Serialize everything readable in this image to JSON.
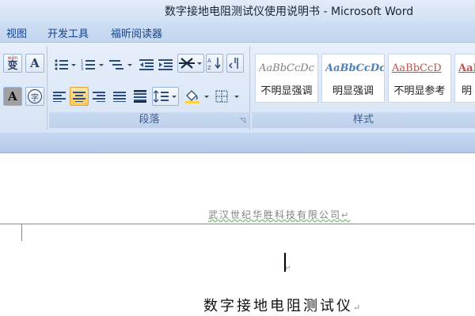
{
  "window": {
    "title": "数字接地电阻测试仪使用说明书 - Microsoft Word"
  },
  "menu": {
    "tabs": [
      "视图",
      "开发工具",
      "福昕阅读器"
    ]
  },
  "ribbon": {
    "font_group": {
      "phonetic_label": "wén",
      "phonetic_char": "变",
      "char_border": "A",
      "char_shade": "A",
      "enclose_char": "字"
    },
    "paragraph_group": {
      "label": "段落"
    },
    "styles_group": {
      "label": "样式",
      "styles": [
        {
          "sample": "AaBbCcDc",
          "name": "不明显强调",
          "color": "#7f7f7f"
        },
        {
          "sample": "AaBbCcDc",
          "name": "明显强调",
          "color": "#4f81bd"
        },
        {
          "sample": "AaBbCcD",
          "name": "不明显参考",
          "color": "#c0504d"
        },
        {
          "sample": "AaI",
          "name": "明",
          "color": "#c0504d"
        }
      ]
    }
  },
  "document": {
    "header_text": "武汉世纪华胜科技有限公司",
    "paragraph_mark": "↵",
    "title": "数字接地电阻测试仪"
  },
  "colors": {
    "accent": "#15428b",
    "active_highlight": "#ffc75a"
  }
}
